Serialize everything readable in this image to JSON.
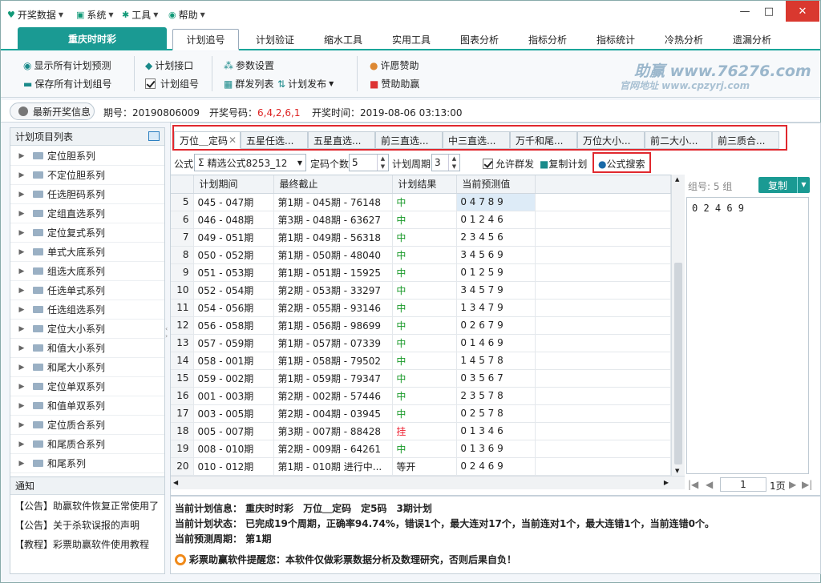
{
  "menu": [
    {
      "icon": "lightbulb-icon",
      "label": "开奖数据"
    },
    {
      "icon": "monitor-icon",
      "label": "系统"
    },
    {
      "icon": "tools-icon",
      "label": "工具"
    },
    {
      "icon": "help-icon",
      "label": "帮助"
    }
  ],
  "window": {
    "minimize": "—",
    "maximize": "□",
    "close": "✕"
  },
  "app_tab": "重庆时时彩",
  "main_tabs": [
    "计划追号",
    "计划验证",
    "缩水工具",
    "实用工具",
    "图表分析",
    "指标分析",
    "指标统计",
    "冷热分析",
    "遗漏分析"
  ],
  "toolbar": {
    "show_all": "显示所有计划预测",
    "save_all": "保存所有计划组号",
    "plan_api": "计划接口",
    "plan_group": "计划组号",
    "params": "参数设置",
    "group_send": "群发列表",
    "plan_publish": "计划发布",
    "wish": "许愿赞助",
    "sponsor": "赞助助赢"
  },
  "brand": {
    "name": "助赢 www.76276.com",
    "sub": "官网地址 www.cpzyrj.com"
  },
  "infobar": {
    "latest_btn": "最新开奖信息",
    "period_label": "期号：",
    "period": "20190806009",
    "code_label": "开奖号码：",
    "code": "6,4,2,6,1",
    "time_label": "开奖时间：",
    "time": "2019-08-06 03:13:00"
  },
  "left_panel": {
    "title": "计划项目列表",
    "items": [
      "定位胆系列",
      "不定位胆系列",
      "任选胆码系列",
      "定组直选系列",
      "定位复式系列",
      "单式大底系列",
      "组选大底系列",
      "任选单式系列",
      "任选组选系列",
      "定位大小系列",
      "和值大小系列",
      "和尾大小系列",
      "定位单双系列",
      "和值单双系列",
      "定位质合系列",
      "和尾质合系列",
      "和尾系列"
    ]
  },
  "notice": {
    "title": "通知",
    "items": [
      "【公告】助赢软件恢复正常使用了",
      "【公告】关于杀软误报的声明",
      "【教程】彩票助赢软件使用教程"
    ]
  },
  "sub_tabs": [
    "万位＿定码",
    "五星任选...",
    "五星直选...",
    "前三直选...",
    "中三直选...",
    "万千和尾...",
    "万位大小...",
    "前二大小...",
    "前三质合..."
  ],
  "options": {
    "formula_label": "公式",
    "formula_value": "精选公式8253_12",
    "count_label": "定码个数",
    "count_value": "5",
    "cycle_label": "计划周期",
    "cycle_value": "3",
    "allow_group": "允许群发",
    "copy_plan": "复制计划",
    "formula_search": "公式搜索"
  },
  "grid": {
    "headers": [
      "计划期间",
      "最终截止",
      "计划结果",
      "当前预测值"
    ],
    "rows": [
      {
        "n": "5",
        "period": "045 - 047期",
        "end": "第1期 - 045期 - 76148",
        "res": "中",
        "pred": "0 4 7 8 9"
      },
      {
        "n": "6",
        "period": "046 - 048期",
        "end": "第3期 - 048期 - 63627",
        "res": "中",
        "pred": "0 1 2 4 6"
      },
      {
        "n": "7",
        "period": "049 - 051期",
        "end": "第1期 - 049期 - 56318",
        "res": "中",
        "pred": "2 3 4 5 6"
      },
      {
        "n": "8",
        "period": "050 - 052期",
        "end": "第1期 - 050期 - 48040",
        "res": "中",
        "pred": "3 4 5 6 9"
      },
      {
        "n": "9",
        "period": "051 - 053期",
        "end": "第1期 - 051期 - 15925",
        "res": "中",
        "pred": "0 1 2 5 9"
      },
      {
        "n": "10",
        "period": "052 - 054期",
        "end": "第2期 - 053期 - 33297",
        "res": "中",
        "pred": "3 4 5 7 9"
      },
      {
        "n": "11",
        "period": "054 - 056期",
        "end": "第2期 - 055期 - 93146",
        "res": "中",
        "pred": "1 3 4 7 9"
      },
      {
        "n": "12",
        "period": "056 - 058期",
        "end": "第1期 - 056期 - 98699",
        "res": "中",
        "pred": "0 2 6 7 9"
      },
      {
        "n": "13",
        "period": "057 - 059期",
        "end": "第1期 - 057期 - 07339",
        "res": "中",
        "pred": "0 1 4 6 9"
      },
      {
        "n": "14",
        "period": "058 - 001期",
        "end": "第1期 - 058期 - 79502",
        "res": "中",
        "pred": "1 4 5 7 8"
      },
      {
        "n": "15",
        "period": "059 - 002期",
        "end": "第1期 - 059期 - 79347",
        "res": "中",
        "pred": "0 3 5 6 7"
      },
      {
        "n": "16",
        "period": "001 - 003期",
        "end": "第2期 - 002期 - 57446",
        "res": "中",
        "pred": "2 3 5 7 8"
      },
      {
        "n": "17",
        "period": "003 - 005期",
        "end": "第2期 - 004期 - 03945",
        "res": "中",
        "pred": "0 2 5 7 8"
      },
      {
        "n": "18",
        "period": "005 - 007期",
        "end": "第3期 - 007期 - 88428",
        "res": "挂",
        "pred": "0 1 3 4 6"
      },
      {
        "n": "19",
        "period": "008 - 010期",
        "end": "第2期 - 009期 - 64261",
        "res": "中",
        "pred": "0 1 3 6 9"
      },
      {
        "n": "20",
        "period": "010 - 012期",
        "end": "第1期 - 010期 进行中...",
        "res": "等开",
        "pred": "0 2 4 6 9"
      }
    ]
  },
  "right_panel": {
    "group_label": "组号: 5 组",
    "copy_btn": "复制",
    "text": "0 2 4 6 9",
    "page_value": "1",
    "page_total": "1页"
  },
  "bottom": {
    "info": "当前计划信息： 重庆时时彩　万位＿定码　定5码　3期计划",
    "status": "当前计划状态： 已完成19个周期，正确率94.74%，错误1个，最大连对17个，当前连对1个，最大连错1个，当前连错0个。",
    "forecast": "当前预测周期： 第1期",
    "warning": "彩票助赢软件提醒您：本软件仅做彩票数据分析及数理研究，否则后果自负！"
  }
}
